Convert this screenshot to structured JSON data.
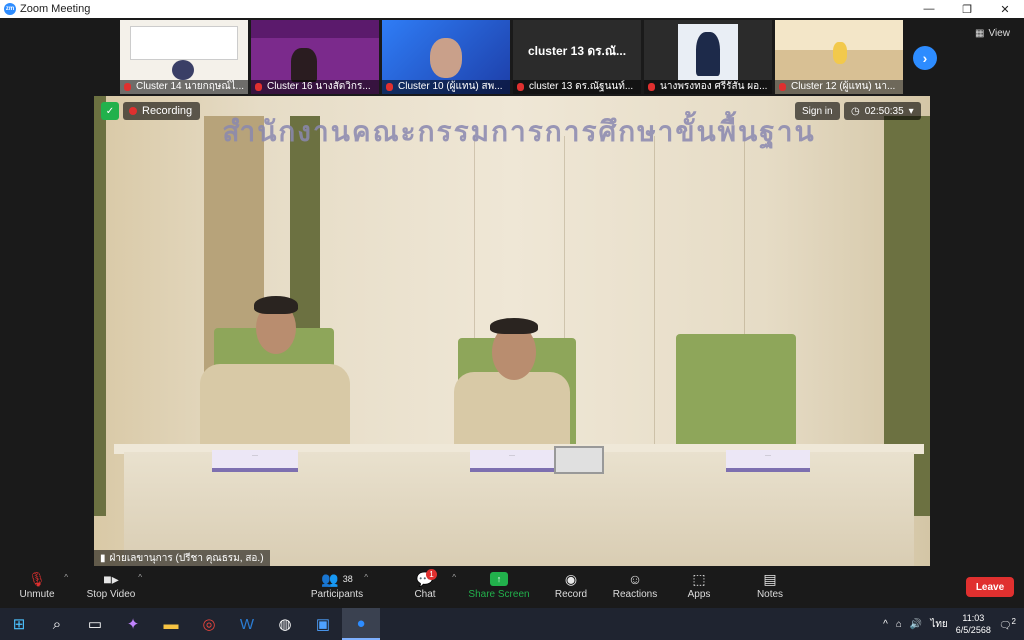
{
  "window": {
    "title": "Zoom Meeting",
    "controls": [
      "—",
      "❐",
      "✕"
    ]
  },
  "view_label": "View",
  "thumbnails": [
    {
      "label": "Cluster 14 นายกฤษณ์ไ...",
      "bg": "#f4f1ea",
      "big": ""
    },
    {
      "label": "Cluster 16 นางสัตวิกร...",
      "bg": "#7b2a8c",
      "big": ""
    },
    {
      "label": "Cluster 10 (ผู้แทน) สพ...",
      "bg": "#2660d9",
      "big": ""
    },
    {
      "label": "cluster 13 ดร.ณัฐนนท์...",
      "bg": "#2b2b2b",
      "big": "cluster 13 ดร.ณั..."
    },
    {
      "label": "นางพรงทอง ศรีรัสัน ผอ...",
      "bg": "#e9eef5",
      "big": ""
    },
    {
      "label": "Cluster 12 (ผู้แทน) นา...",
      "bg": "#f3e6c8",
      "big": ""
    }
  ],
  "main": {
    "recording_label": "Recording",
    "signin_label": "Sign in",
    "timer": "02:50:35",
    "signage": "สำนักงานคณะกรรมการการศึกษาขั้นพื้นฐาน",
    "speaker": "ฝ่ายเลขานุการ (ปรีชา คุณธรม, สอ.)"
  },
  "toolbar": {
    "unmute": "Unmute",
    "stop_video": "Stop Video",
    "participants": "Participants",
    "participants_count": "38",
    "chat": "Chat",
    "chat_badge": "1",
    "share_screen": "Share Screen",
    "record": "Record",
    "reactions": "Reactions",
    "apps": "Apps",
    "notes": "Notes",
    "leave": "Leave"
  },
  "taskbar": {
    "lang": "ไทย",
    "time": "11:03",
    "date": "6/5/2568",
    "notif_count": "2"
  },
  "colors": {
    "zoom_blue": "#2d8cff",
    "leave_red": "#e0302f",
    "share_green": "#22b14c"
  }
}
